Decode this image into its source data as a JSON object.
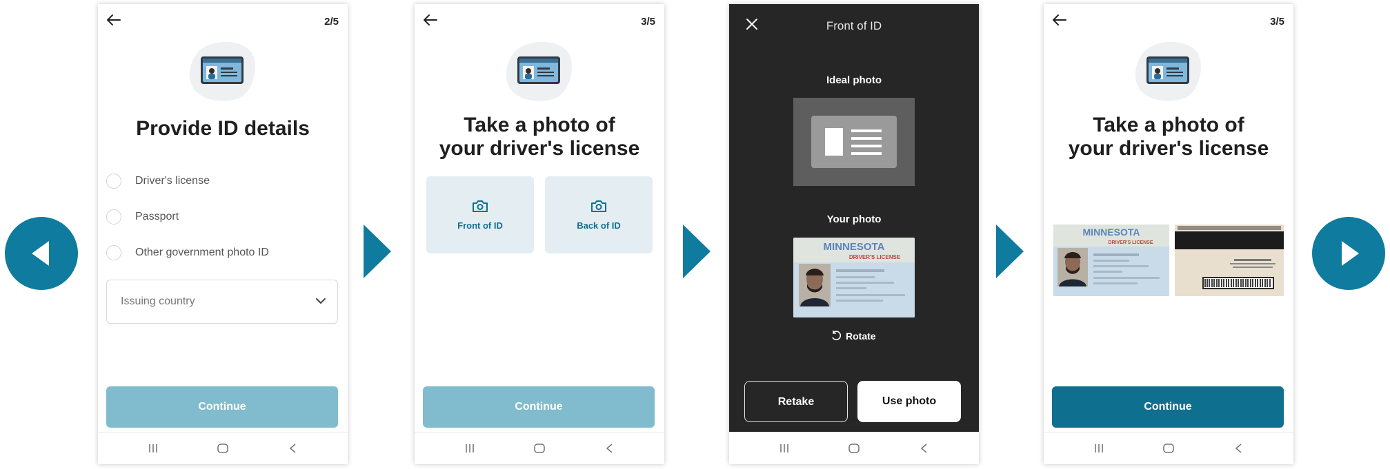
{
  "screens": [
    {
      "step": "2/5",
      "title": "Provide ID details",
      "options": [
        "Driver's license",
        "Passport",
        "Other government photo ID"
      ],
      "country_placeholder": "Issuing country",
      "continue_label": "Continue",
      "continue_state": "disabled"
    },
    {
      "step": "3/5",
      "title_line1": "Take a photo of",
      "title_line2": "your driver's license",
      "front_label": "Front of ID",
      "back_label": "Back of ID",
      "continue_label": "Continue",
      "continue_state": "disabled"
    },
    {
      "title": "Front of ID",
      "ideal_label": "Ideal photo",
      "your_label": "Your photo",
      "license_state": "MINNESOTA",
      "license_type": "DRIVER'S LICENSE",
      "rotate_label": "Rotate",
      "retake_label": "Retake",
      "use_label": "Use photo"
    },
    {
      "step": "3/5",
      "title_line1": "Take a photo of",
      "title_line2": "your driver's license",
      "license_state": "MINNESOTA",
      "license_type": "DRIVER'S LICENSE",
      "continue_label": "Continue",
      "continue_state": "enabled"
    }
  ],
  "colors": {
    "accent": "#0f7b9e",
    "button_disabled": "#80bccd",
    "button_enabled": "#0f6f8f",
    "tile_bg": "#e4eef2",
    "dark_bg": "#262626"
  },
  "icons": [
    "back-arrow-icon",
    "close-icon",
    "camera-icon",
    "chevron-down-icon",
    "rotate-icon",
    "id-card-icon",
    "recent-apps-icon",
    "home-icon",
    "system-back-icon",
    "previous-icon",
    "next-icon",
    "flow-arrow-icon"
  ]
}
